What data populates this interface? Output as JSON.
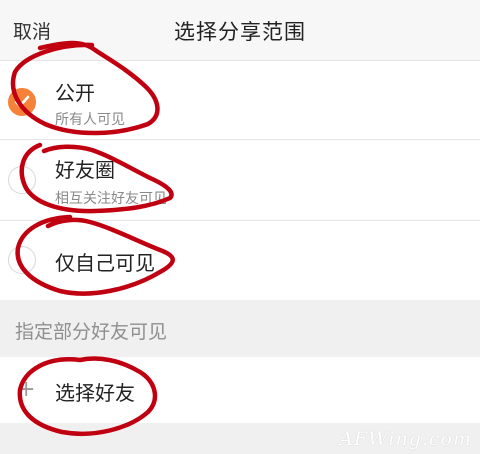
{
  "header": {
    "cancel_label": "取消",
    "title": "选择分享范围"
  },
  "options": [
    {
      "label": "公开",
      "sublabel": "所有人可见",
      "selected": true
    },
    {
      "label": "好友圈",
      "sublabel": "相互关注好友可见",
      "selected": false
    },
    {
      "label": "仅自己可见",
      "selected": false
    }
  ],
  "section": {
    "title": "指定部分好友可见"
  },
  "select_friends": {
    "label": "选择好友",
    "icon": "plus-icon"
  },
  "watermark": "AFWing.com",
  "colors": {
    "accent": "#f6823a",
    "annotation": "#c00010",
    "section_bg": "#f0f0f0"
  }
}
